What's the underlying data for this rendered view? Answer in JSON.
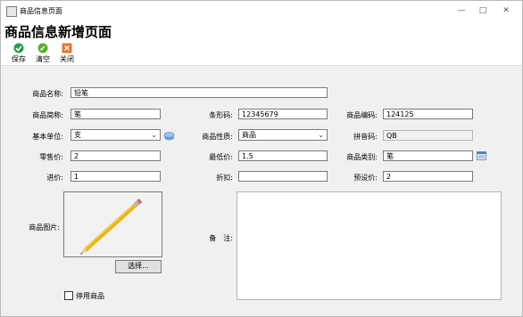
{
  "window": {
    "title": "商品信息页面"
  },
  "page_title": "商品信息新增页面",
  "toolbar": {
    "save": "保存",
    "clear": "清空",
    "close": "关闭"
  },
  "form": {
    "name": {
      "label": "商品名称:",
      "value": "铅笔"
    },
    "short_name": {
      "label": "商品简称:",
      "value": "笔"
    },
    "barcode": {
      "label": "条形码:",
      "value": "12345679"
    },
    "code": {
      "label": "商品编码:",
      "value": "124125"
    },
    "unit": {
      "label": "基本单位:",
      "value": "支"
    },
    "nature": {
      "label": "商品性质:",
      "value": "商品"
    },
    "pinyin": {
      "label": "拼音码:",
      "value": "QB"
    },
    "retail_price": {
      "label": "零售价:",
      "value": "2"
    },
    "min_price": {
      "label": "最低价:",
      "value": "1.5"
    },
    "category": {
      "label": "商品类别:",
      "value": "笔"
    },
    "purchase_price": {
      "label": "进价:",
      "value": "1"
    },
    "discount": {
      "label": "折扣:",
      "value": ""
    },
    "preset_price": {
      "label": "预设价:",
      "value": "2"
    },
    "image_label": "商品图片:",
    "choose_button": "选择...",
    "remark_label": "备　注:",
    "disabled_label": "停用商品"
  },
  "colors": {
    "save_icon": "#22a046",
    "clear_icon": "#5cae2a",
    "close_icon": "#e8742a"
  }
}
